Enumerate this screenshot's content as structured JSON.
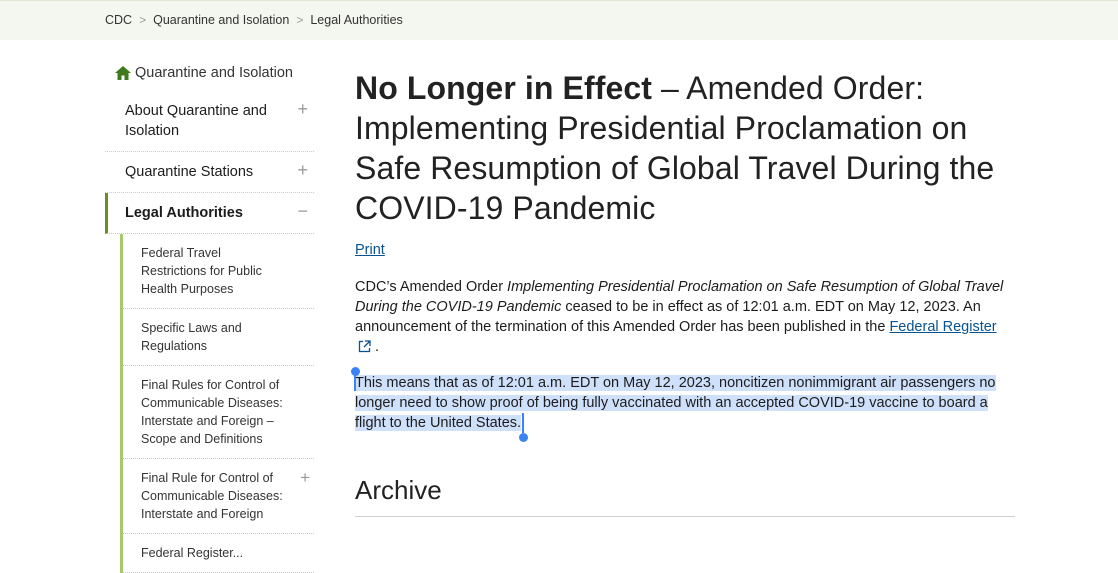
{
  "breadcrumb": {
    "items": [
      "CDC",
      "Quarantine and Isolation",
      "Legal Authorities"
    ],
    "separator": ">"
  },
  "sidebar": {
    "home_label": "Quarantine and Isolation",
    "home_icon": "home-icon",
    "items": [
      {
        "label": "About Quarantine and Isolation",
        "toggle": "+"
      },
      {
        "label": "Quarantine Stations",
        "toggle": "+"
      },
      {
        "label": "Legal Authorities",
        "toggle": "−"
      }
    ],
    "sub_items": [
      {
        "label": "Federal Travel Restrictions for Public Health Purposes",
        "toggle": ""
      },
      {
        "label": "Specific Laws and Regulations",
        "toggle": ""
      },
      {
        "label": "Final Rules for Control of Communicable Diseases: Interstate and Foreign – Scope and Definitions",
        "toggle": ""
      },
      {
        "label": "Final Rule for Control of Communicable Diseases: Interstate and Foreign",
        "toggle": "+"
      },
      {
        "label": "Federal Register...",
        "toggle": ""
      }
    ]
  },
  "main": {
    "title_strong": "No Longer in Effect",
    "title_rest": " – Amended Order: Implementing Presidential Proclamation on Safe Resumption of Global Travel During the COVID-19 Pandemic",
    "print_label": "Print",
    "para1_a": "CDC’s Amended Order ",
    "para1_em": "Implementing Presidential Proclamation on Safe Resumption of Global Travel During the COVID-19 Pandemic",
    "para1_b": " ceased to be in effect as of 12:01 a.m. EDT on May 12, 2023. An announcement of the termination of this Amended Order has been published in the ",
    "para1_link": "Federal Register",
    "para1_end": ".",
    "para2": "This means that as of 12:01 a.m. EDT on May 12, 2023, noncitizen nonimmigrant air passengers no longer need to show proof of being fully vaccinated with an accepted COVID-19 vaccine to board a flight to the United States.",
    "archive_heading": "Archive"
  },
  "colors": {
    "breadcrumb_bg": "#f4f7ef",
    "accent_green": "#6b8e23",
    "link_blue": "#075290",
    "selection": "#cfe0fb",
    "selection_handle": "#3b82f6"
  }
}
